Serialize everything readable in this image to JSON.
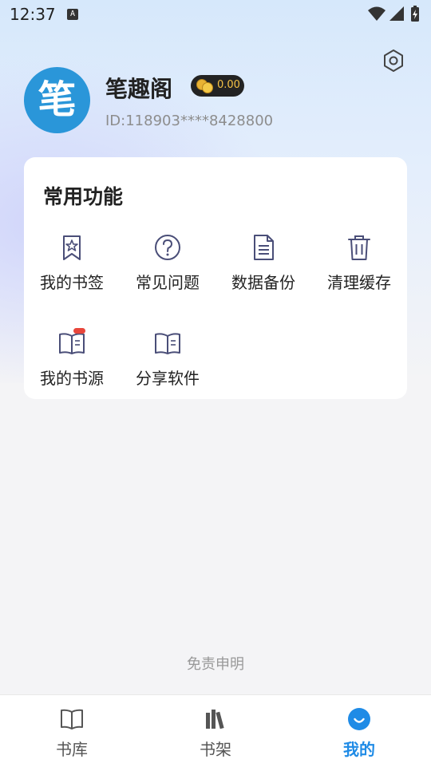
{
  "status_bar": {
    "time": "12:37",
    "badge": "A"
  },
  "profile": {
    "avatar_char": "笔",
    "username": "笔趣阁",
    "coins": "0.00",
    "user_id": "ID:118903****8428800"
  },
  "functions": {
    "title": "常用功能",
    "items": [
      {
        "label": "我的书签",
        "icon": "bookmark-icon"
      },
      {
        "label": "常见问题",
        "icon": "question-circle-icon"
      },
      {
        "label": "数据备份",
        "icon": "document-icon"
      },
      {
        "label": "清理缓存",
        "icon": "trash-icon"
      },
      {
        "label": "我的书源",
        "icon": "book-source-icon"
      },
      {
        "label": "分享软件",
        "icon": "open-book-icon"
      }
    ]
  },
  "footer": {
    "disclaimer": "免责申明"
  },
  "bottom_nav": {
    "items": [
      {
        "label": "书库",
        "icon": "book-icon"
      },
      {
        "label": "书架",
        "icon": "bookshelf-icon"
      },
      {
        "label": "我的",
        "icon": "smile-icon"
      }
    ],
    "active_index": 2,
    "active_color": "#1f8be6"
  },
  "colors": {
    "icon_stroke": "#4a4e78",
    "accent": "#1f8be6",
    "avatar_bg": "#2a96d9"
  }
}
